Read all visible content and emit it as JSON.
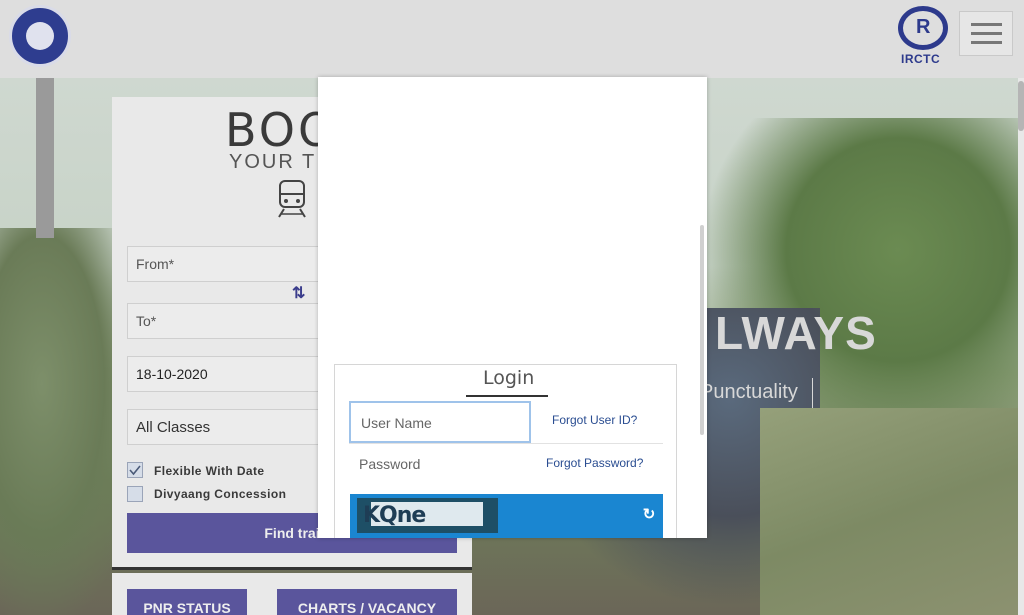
{
  "header": {
    "left_logo": "indian-railways-logo",
    "right_logo_mark": "R",
    "right_logo_text": "IRCTC",
    "menu_icon": "hamburger-icon"
  },
  "hero": {
    "title": "LWAYS",
    "subtitle": "Punctuality"
  },
  "booking": {
    "title": "BOO",
    "subtitle": "YOUR TIC",
    "from_placeholder": "From*",
    "to_placeholder": "To*",
    "swap_icon": "⇅",
    "date_value": "18-10-2020",
    "class_value": "All Classes",
    "flexible_label": "Flexible With Date",
    "flexible_checked": true,
    "divyaang_label": "Divyaang Concession",
    "divyaang_checked": false,
    "find_button": "Find trai"
  },
  "bottom_buttons": {
    "pnr": "PNR STATUS",
    "charts": "CHARTS / VACANCY"
  },
  "login": {
    "title": "Login",
    "username_placeholder": "User Name",
    "forgot_user_id": "Forgot User ID?",
    "password_placeholder": "Password",
    "forgot_password": "Forgot Password?",
    "captcha_text": "KQne",
    "refresh_icon": "↻"
  },
  "colors": {
    "primary_button": "#5a559c",
    "captcha_bar": "#1a86d1",
    "link": "#2a4d91",
    "input_focus": "#9fc3ea"
  }
}
